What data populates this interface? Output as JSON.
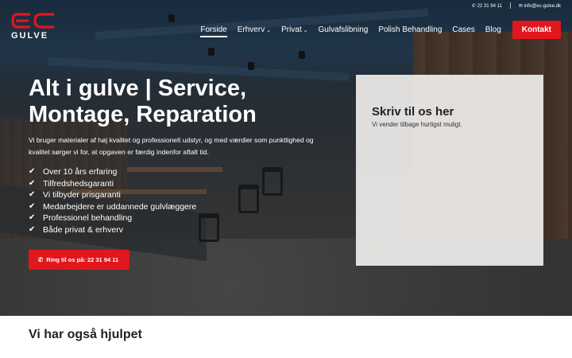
{
  "topbar": {
    "phone": "22 31 94 11",
    "email": "info@ec-gulve.dk"
  },
  "logo": {
    "mark_text": "EC",
    "brand_text": "GULVE"
  },
  "nav": {
    "items": [
      {
        "label": "Forside",
        "active": true,
        "dropdown": false
      },
      {
        "label": "Erhverv",
        "active": false,
        "dropdown": true
      },
      {
        "label": "Privat",
        "active": false,
        "dropdown": true
      },
      {
        "label": "Gulvafslibning",
        "active": false,
        "dropdown": false
      },
      {
        "label": "Polish Behandling",
        "active": false,
        "dropdown": false
      },
      {
        "label": "Cases",
        "active": false,
        "dropdown": false
      },
      {
        "label": "Blog",
        "active": false,
        "dropdown": false
      }
    ],
    "cta_label": "Kontakt"
  },
  "hero": {
    "title_line1": "Alt i gulve | Service,",
    "title_line2": "Montage, Reparation",
    "subtitle": "Vi bruger materialer af høj kvalitet og professionelt udstyr, og med værdier som punktlighed og kvalitet sørger vi for, at opgaven er færdig indenfor aftalt tid.",
    "checklist": [
      "Over 10 års erfaring",
      "Tilfredshedsgaranti",
      "Vi tilbyder prisgaranti",
      "Medarbejdere er uddannede gulvlæggere",
      "Professionel behandling",
      "Både privat & erhverv"
    ],
    "call_button": "Ring til os på: 22 31 94 11"
  },
  "form": {
    "title": "Skriv til os her",
    "subtitle": "Vi vender tilbage hurtigst muligt."
  },
  "section": {
    "title": "Vi har også hjulpet"
  },
  "colors": {
    "accent": "#e2161d",
    "text_dark": "#222222"
  },
  "icons": {
    "phone": "phone-icon",
    "email": "envelope-icon",
    "check": "check-icon",
    "caret": "chevron-down-icon"
  }
}
